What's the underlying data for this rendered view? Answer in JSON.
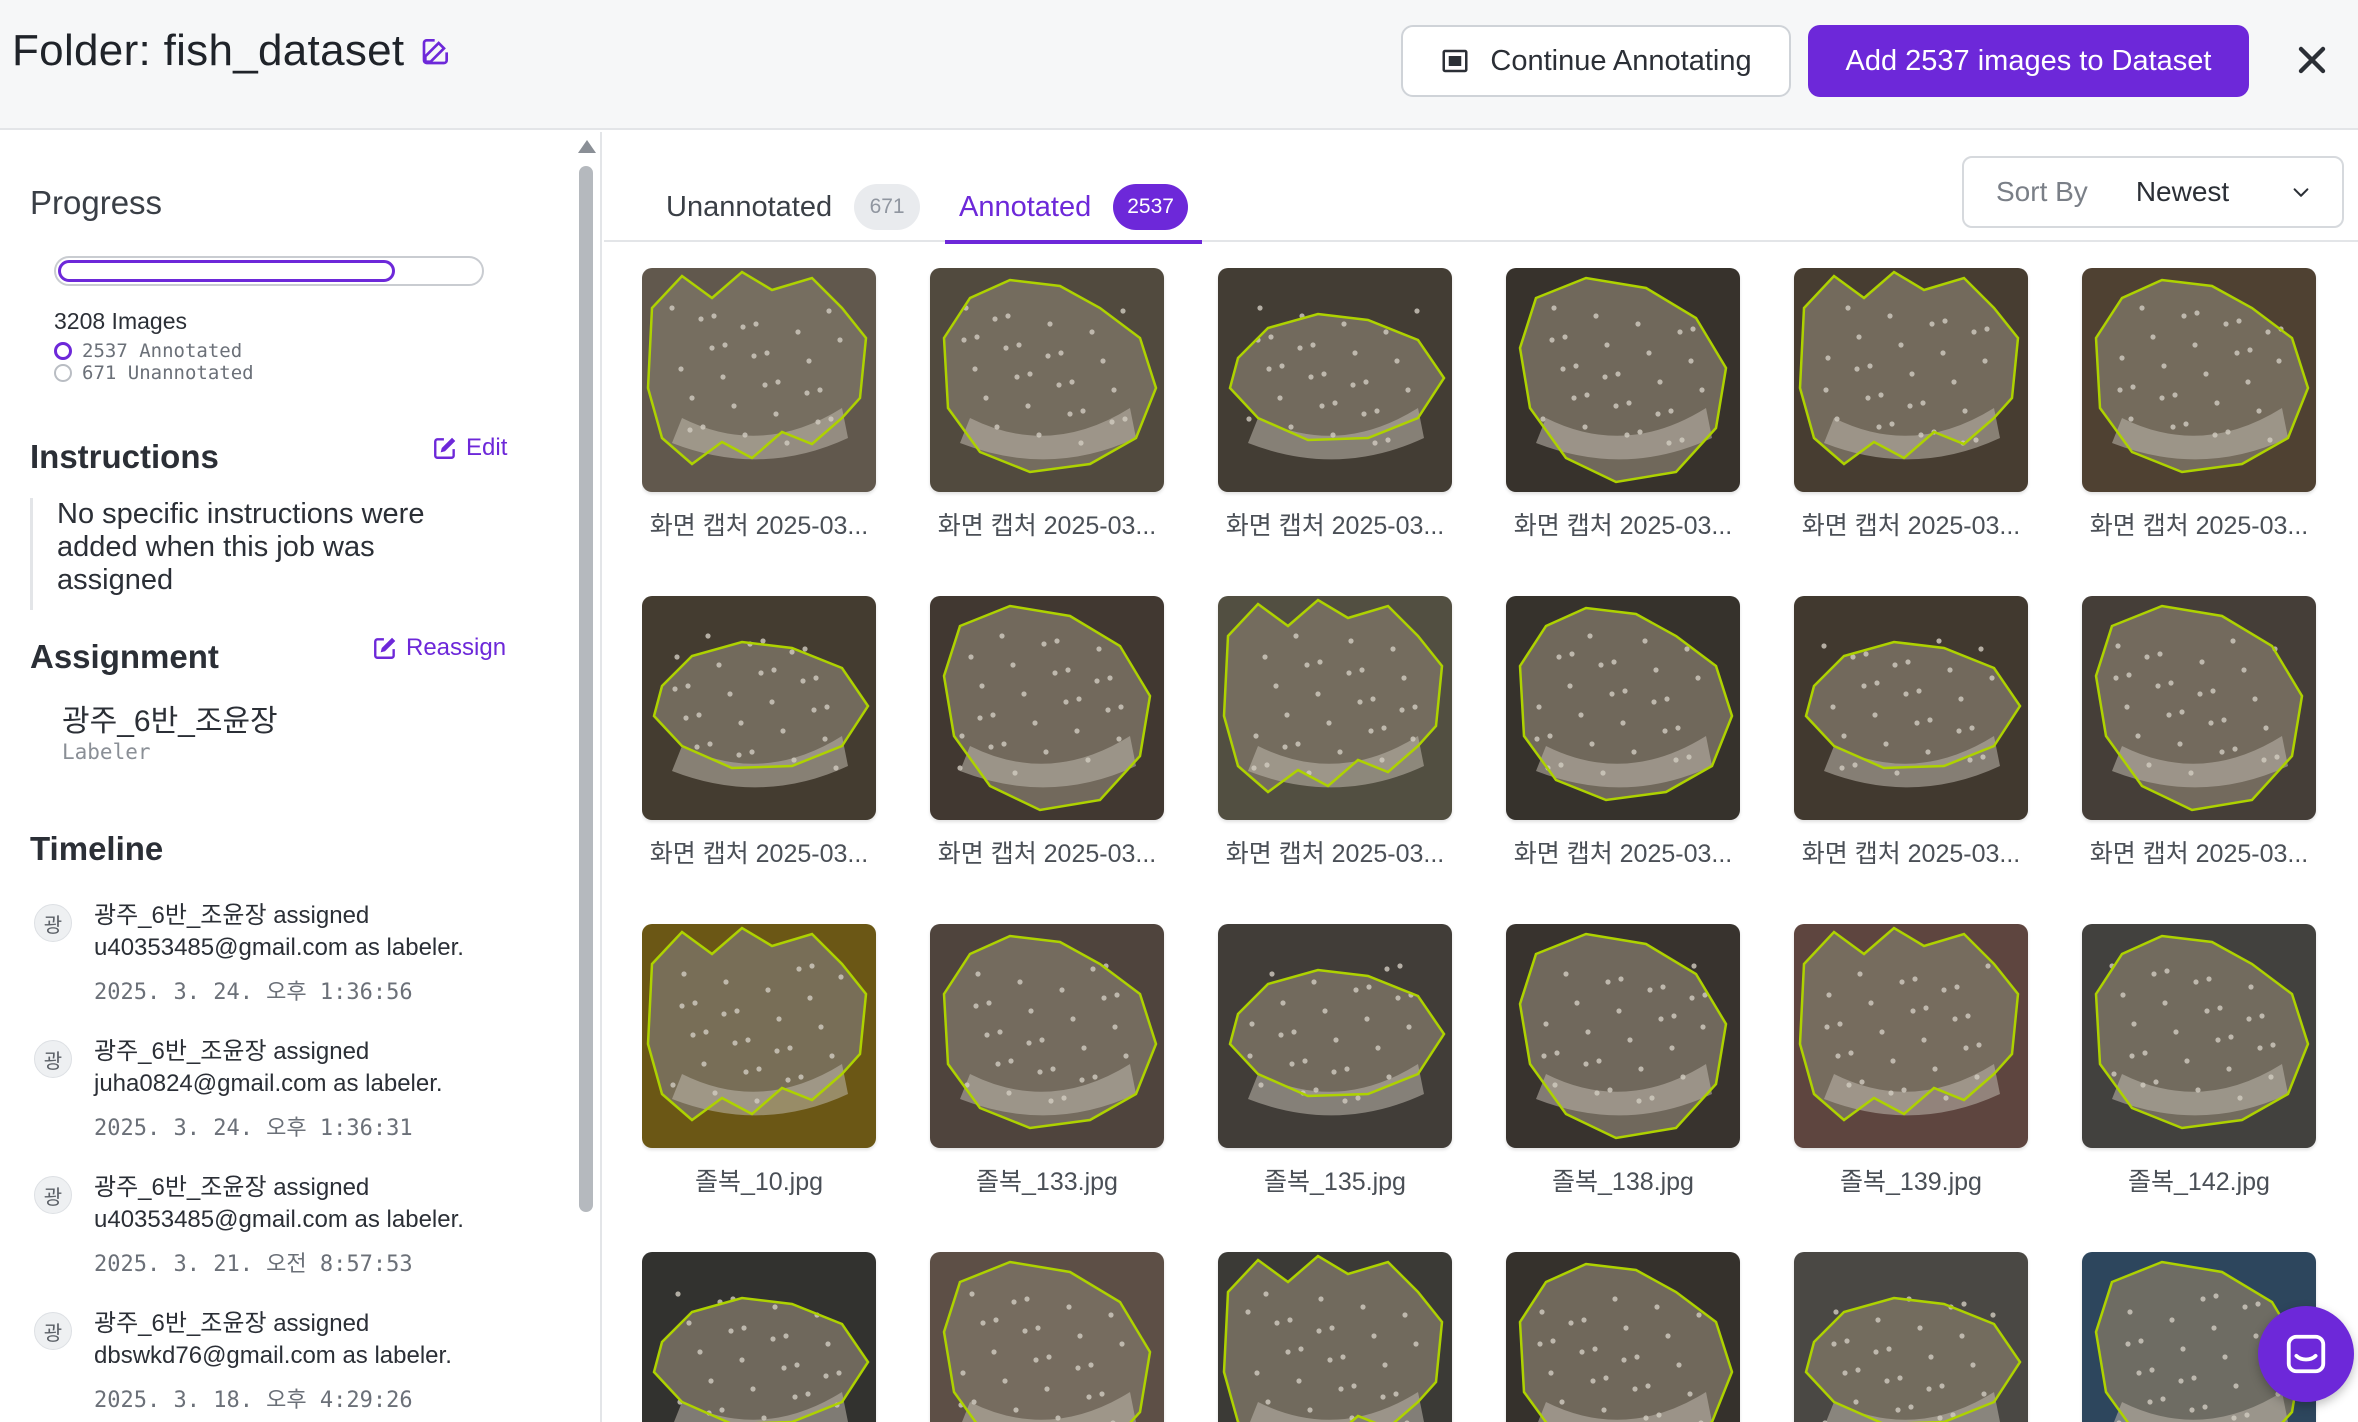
{
  "header": {
    "title": "Folder: fish_dataset",
    "continue_label": "Continue Annotating",
    "add_label": "Add 2537 images to Dataset"
  },
  "sidebar": {
    "progress": {
      "heading": "Progress",
      "fraction_annotated": 0.79,
      "total_label": "3208 Images",
      "annotated_label": "2537 Annotated",
      "unannotated_label": "671 Unannotated"
    },
    "instructions": {
      "heading": "Instructions",
      "edit_label": "Edit",
      "text": "No specific instructions were added when this job was assigned"
    },
    "assignment": {
      "heading": "Assignment",
      "reassign_label": "Reassign",
      "assignee": "광주_6반_조윤장",
      "role": "Labeler"
    },
    "timeline": {
      "heading": "Timeline",
      "items": [
        {
          "avatar": "광",
          "line1": "광주_6반_조윤장 assigned",
          "line2": "u40353485@gmail.com as labeler.",
          "date": "2025. 3. 24. 오후 1:36:56"
        },
        {
          "avatar": "광",
          "line1": "광주_6반_조윤장 assigned",
          "line2": "juha0824@gmail.com as labeler.",
          "date": "2025. 3. 24. 오후 1:36:31"
        },
        {
          "avatar": "광",
          "line1": "광주_6반_조윤장 assigned",
          "line2": "u40353485@gmail.com as labeler.",
          "date": "2025. 3. 21. 오전 8:57:53"
        },
        {
          "avatar": "광",
          "line1": "광주_6반_조윤장 assigned",
          "line2": "dbswkd76@gmail.com as labeler.",
          "date": "2025. 3. 18. 오후 4:29:26"
        }
      ]
    }
  },
  "tabs": {
    "unannotated": {
      "label": "Unannotated",
      "count": "671"
    },
    "annotated": {
      "label": "Annotated",
      "count": "2537"
    }
  },
  "sort": {
    "label": "Sort By",
    "value": "Newest"
  },
  "images": [
    {
      "caption": "화면 캡처 2025-03...",
      "bg": "#6f6558"
    },
    {
      "caption": "화면 캡처 2025-03...",
      "bg": "#5d5547"
    },
    {
      "caption": "화면 캡처 2025-03...",
      "bg": "#4d463c"
    },
    {
      "caption": "화면 캡처 2025-03...",
      "bg": "#3f3a33"
    },
    {
      "caption": "화면 캡처 2025-03...",
      "bg": "#514638"
    },
    {
      "caption": "화면 캡처 2025-03...",
      "bg": "#5a4a3a"
    },
    {
      "caption": "화면 캡처 2025-03...",
      "bg": "#4e4537"
    },
    {
      "caption": "화면 캡처 2025-03...",
      "bg": "#4a4038"
    },
    {
      "caption": "화면 캡처 2025-03...",
      "bg": "#5e5a4a"
    },
    {
      "caption": "화면 캡처 2025-03...",
      "bg": "#3e3a33"
    },
    {
      "caption": "화면 캡처 2025-03...",
      "bg": "#4a4136"
    },
    {
      "caption": "화면 캡처 2025-03...",
      "bg": "#4f4740"
    },
    {
      "caption": "졸복_10.jpg",
      "bg": "#7a6418"
    },
    {
      "caption": "졸복_133.jpg",
      "bg": "#5a4e46"
    },
    {
      "caption": "졸복_135.jpg",
      "bg": "#4a4640"
    },
    {
      "caption": "졸복_138.jpg",
      "bg": "#403b35"
    },
    {
      "caption": "졸복_139.jpg",
      "bg": "#6b4f48"
    },
    {
      "caption": "졸복_142.jpg",
      "bg": "#4c4a47"
    },
    {
      "caption": "",
      "bg": "#3a3a36"
    },
    {
      "caption": "",
      "bg": "#6a5b50"
    },
    {
      "caption": "",
      "bg": "#44423e"
    },
    {
      "caption": "",
      "bg": "#3d3833"
    },
    {
      "caption": "",
      "bg": "#55534e"
    },
    {
      "caption": "",
      "bg": "#34506a"
    }
  ],
  "colors": {
    "accent": "#6d28d9",
    "annotation_outline": "#c6f000"
  }
}
